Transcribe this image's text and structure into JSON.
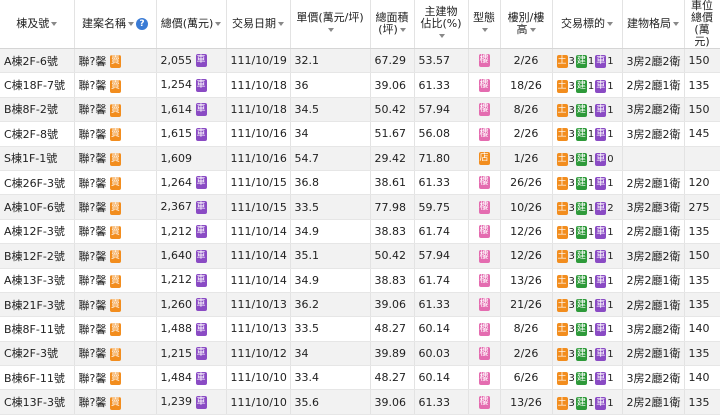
{
  "headers": {
    "building": "棟及號",
    "project": "建案名稱",
    "total": "總價(萬元)",
    "date": "交易日期",
    "unit": "單價(萬元/坪)",
    "area": "總面積 (坪)",
    "ratio": "主建物 佔比(%)",
    "type": "型態",
    "floor": "樓別/樓高",
    "target": "交易標的",
    "layout": "建物格局",
    "parking": "車位總價 (萬元)"
  },
  "help_glyph": "?",
  "badges": {
    "project": "賣",
    "car": "車",
    "building_type": "樓",
    "shop_type": "店",
    "land": "土",
    "bldg": "建",
    "car2": "車"
  },
  "colors": {
    "orange": "#f28d1e",
    "purple": "#8a4bc4",
    "pink": "#e46cb0",
    "green": "#2e9a3a"
  },
  "rows": [
    {
      "bld": "A棟2F-6號",
      "proj": "聯?馨",
      "total": "2,055",
      "car": true,
      "date": "111/10/19",
      "unit": "32.1",
      "area": "67.29",
      "ratio": "53.57",
      "type": "樓",
      "floor": "2/26",
      "land": "3",
      "bldg": "1",
      "carn": "1",
      "layout": "3房2廳2衛",
      "park": "150"
    },
    {
      "bld": "C棟18F-7號",
      "proj": "聯?馨",
      "total": "1,254",
      "car": true,
      "date": "111/10/18",
      "unit": "36",
      "area": "39.06",
      "ratio": "61.33",
      "type": "樓",
      "floor": "18/26",
      "land": "3",
      "bldg": "1",
      "carn": "1",
      "layout": "2房2廳1衛",
      "park": "135"
    },
    {
      "bld": "B棟8F-2號",
      "proj": "聯?馨",
      "total": "1,614",
      "car": true,
      "date": "111/10/18",
      "unit": "34.5",
      "area": "50.42",
      "ratio": "57.94",
      "type": "樓",
      "floor": "8/26",
      "land": "3",
      "bldg": "1",
      "carn": "1",
      "layout": "3房2廳2衛",
      "park": "150"
    },
    {
      "bld": "C棟2F-8號",
      "proj": "聯?馨",
      "total": "1,615",
      "car": true,
      "date": "111/10/16",
      "unit": "34",
      "area": "51.67",
      "ratio": "56.08",
      "type": "樓",
      "floor": "2/26",
      "land": "3",
      "bldg": "1",
      "carn": "1",
      "layout": "3房2廳2衛",
      "park": "145"
    },
    {
      "bld": "S棟1F-1號",
      "proj": "聯?馨",
      "total": "1,609",
      "car": false,
      "date": "111/10/16",
      "unit": "54.7",
      "area": "29.42",
      "ratio": "71.80",
      "type": "店",
      "floor": "1/26",
      "land": "3",
      "bldg": "1",
      "carn": "0",
      "layout": "",
      "park": ""
    },
    {
      "bld": "C棟26F-3號",
      "proj": "聯?馨",
      "total": "1,264",
      "car": true,
      "date": "111/10/15",
      "unit": "36.8",
      "area": "38.61",
      "ratio": "61.33",
      "type": "樓",
      "floor": "26/26",
      "land": "3",
      "bldg": "1",
      "carn": "1",
      "layout": "2房2廳1衛",
      "park": "120"
    },
    {
      "bld": "A棟10F-6號",
      "proj": "聯?馨",
      "total": "2,367",
      "car": true,
      "date": "111/10/15",
      "unit": "33.5",
      "area": "77.98",
      "ratio": "59.75",
      "type": "樓",
      "floor": "10/26",
      "land": "3",
      "bldg": "1",
      "carn": "2",
      "layout": "3房2廳3衛",
      "park": "275"
    },
    {
      "bld": "A棟12F-3號",
      "proj": "聯?馨",
      "total": "1,212",
      "car": true,
      "date": "111/10/14",
      "unit": "34.9",
      "area": "38.83",
      "ratio": "61.74",
      "type": "樓",
      "floor": "12/26",
      "land": "3",
      "bldg": "1",
      "carn": "1",
      "layout": "2房2廳1衛",
      "park": "135"
    },
    {
      "bld": "B棟12F-2號",
      "proj": "聯?馨",
      "total": "1,640",
      "car": true,
      "date": "111/10/14",
      "unit": "35.1",
      "area": "50.42",
      "ratio": "57.94",
      "type": "樓",
      "floor": "12/26",
      "land": "3",
      "bldg": "1",
      "carn": "1",
      "layout": "3房2廳2衛",
      "park": "150"
    },
    {
      "bld": "A棟13F-3號",
      "proj": "聯?馨",
      "total": "1,212",
      "car": true,
      "date": "111/10/14",
      "unit": "34.9",
      "area": "38.83",
      "ratio": "61.74",
      "type": "樓",
      "floor": "13/26",
      "land": "3",
      "bldg": "1",
      "carn": "1",
      "layout": "2房2廳1衛",
      "park": "135"
    },
    {
      "bld": "B棟21F-3號",
      "proj": "聯?馨",
      "total": "1,260",
      "car": true,
      "date": "111/10/13",
      "unit": "36.2",
      "area": "39.06",
      "ratio": "61.33",
      "type": "樓",
      "floor": "21/26",
      "land": "3",
      "bldg": "1",
      "carn": "1",
      "layout": "2房2廳1衛",
      "park": "135"
    },
    {
      "bld": "B棟8F-11號",
      "proj": "聯?馨",
      "total": "1,488",
      "car": true,
      "date": "111/10/13",
      "unit": "33.5",
      "area": "48.27",
      "ratio": "60.14",
      "type": "樓",
      "floor": "8/26",
      "land": "3",
      "bldg": "1",
      "carn": "1",
      "layout": "3房2廳2衛",
      "park": "140"
    },
    {
      "bld": "C棟2F-3號",
      "proj": "聯?馨",
      "total": "1,215",
      "car": true,
      "date": "111/10/12",
      "unit": "34",
      "area": "39.89",
      "ratio": "60.03",
      "type": "樓",
      "floor": "2/26",
      "land": "3",
      "bldg": "1",
      "carn": "1",
      "layout": "2房2廳1衛",
      "park": "135"
    },
    {
      "bld": "B棟6F-11號",
      "proj": "聯?馨",
      "total": "1,484",
      "car": true,
      "date": "111/10/10",
      "unit": "33.4",
      "area": "48.27",
      "ratio": "60.14",
      "type": "樓",
      "floor": "6/26",
      "land": "3",
      "bldg": "1",
      "carn": "1",
      "layout": "3房2廳2衛",
      "park": "140"
    },
    {
      "bld": "C棟13F-3號",
      "proj": "聯?馨",
      "total": "1,239",
      "car": true,
      "date": "111/10/10",
      "unit": "35.6",
      "area": "39.06",
      "ratio": "61.33",
      "type": "樓",
      "floor": "13/26",
      "land": "3",
      "bldg": "1",
      "carn": "1",
      "layout": "2房2廳1衛",
      "park": "135"
    }
  ]
}
